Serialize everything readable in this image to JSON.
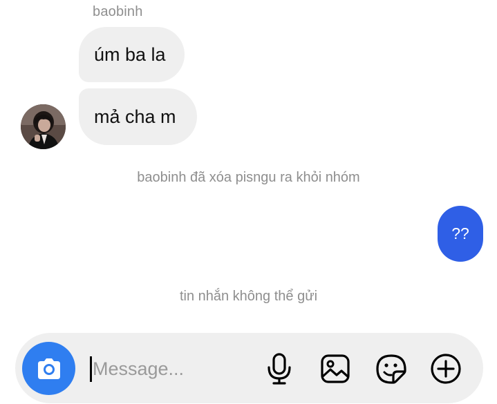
{
  "conversation": {
    "sender_name": "baobinh",
    "messages_in": [
      {
        "text": "úm ba la"
      },
      {
        "text": "mả cha m"
      }
    ],
    "system_notes": [
      "baobinh đã xóa pisngu ra khỏi nhóm",
      "tin nhắn không thể gửi"
    ],
    "message_out": "??"
  },
  "composer": {
    "placeholder": "Message...",
    "icons": [
      "camera-icon",
      "microphone-icon",
      "gallery-icon",
      "sticker-icon",
      "plus-icon"
    ]
  },
  "colors": {
    "outgoing_bubble": "#2f5fe6",
    "incoming_bubble": "#efefef",
    "camera_button": "#2f7ef0",
    "muted_text": "#8e8e8e"
  }
}
